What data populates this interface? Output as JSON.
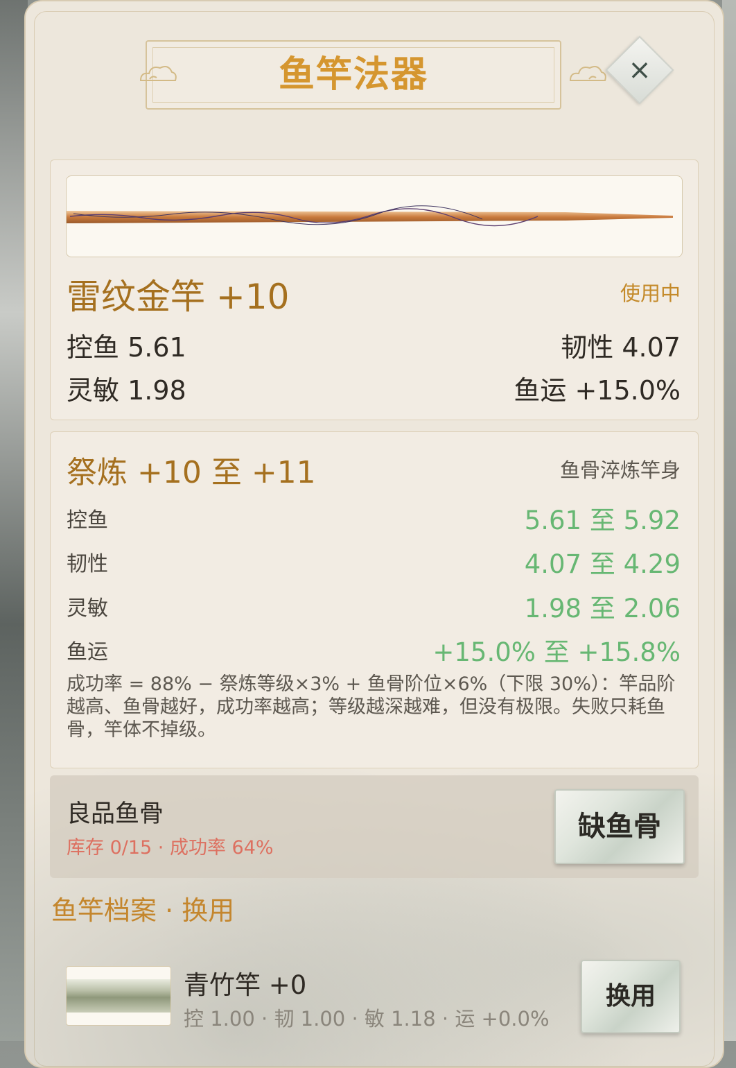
{
  "dialog": {
    "title": "鱼竿法器",
    "close_label": "×"
  },
  "current_rod": {
    "name": "雷纹金竿 +10",
    "status": "使用中",
    "stats": {
      "control": "控鱼 5.61",
      "toughness": "韧性 4.07",
      "agility": "灵敏 1.98",
      "luck": "鱼运 +15.0%"
    }
  },
  "refine": {
    "title": "祭炼 +10 至 +11",
    "subtitle": "鱼骨淬炼竿身",
    "rows": [
      {
        "label": "控鱼",
        "value": "5.61 至 5.92"
      },
      {
        "label": "韧性",
        "value": "4.07 至 4.29"
      },
      {
        "label": "灵敏",
        "value": "1.98 至 2.06"
      },
      {
        "label": "鱼运",
        "value": "+15.0% 至 +15.8%"
      }
    ],
    "formula": "成功率 = 88% − 祭炼等级×3% + 鱼骨阶位×6%（下限 30%）：竿品阶越高、鱼骨越好，成功率越高；等级越深越难，但没有极限。失败只耗鱼骨，竿体不掉级。"
  },
  "material": {
    "name": "良品鱼骨",
    "meta": "库存 0/15 · 成功率 64%",
    "button_label": "缺鱼骨"
  },
  "archive": {
    "title": "鱼竿档案 · 换用",
    "items": [
      {
        "name": "青竹竿 +0",
        "stats": "控 1.00 · 韧 1.00 · 敏 1.18 · 运 +0.0%",
        "button_label": "换用"
      }
    ]
  },
  "colors": {
    "accent_gold": "#d5962f",
    "rod_name": "#a5701f",
    "refine_value_green": "#67b773",
    "warning_red": "#dd7060",
    "panel_bg": "#ede7dc"
  }
}
